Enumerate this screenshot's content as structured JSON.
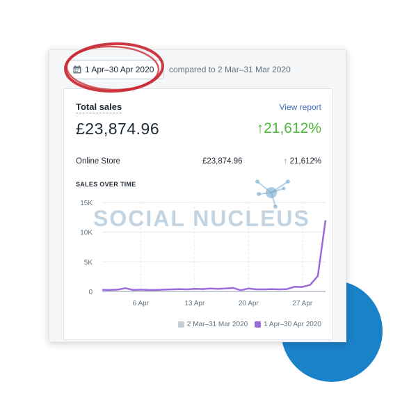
{
  "header": {
    "date_range": "1 Apr–30 Apr 2020",
    "compare_text": "compared to 2 Mar–31 Mar 2020"
  },
  "card": {
    "title": "Total sales",
    "view_report": "View report",
    "total_value": "£23,874.96",
    "total_growth": "21,612%",
    "rows": [
      {
        "name": "Online Store",
        "value": "£23,874.96",
        "growth": "21,612%"
      }
    ]
  },
  "chart_title": "SALES OVER TIME",
  "watermark": "SOCIAL NUCLEUS",
  "colors": {
    "accent_blue": "#1a82c8",
    "growth_green": "#50b83c",
    "series_current": "#9c6ade",
    "series_previous": "#c4cdd5",
    "annotation_red": "#c8242f"
  },
  "icons": {
    "calendar": "calendar-icon",
    "arrow_up": "arrow-up-icon"
  },
  "chart_data": {
    "type": "line",
    "ylim": [
      0,
      15000
    ],
    "yticks": [
      0,
      5000,
      10000,
      15000
    ],
    "ytick_labels": [
      "0",
      "5K",
      "10K",
      "15K"
    ],
    "xtick_days": [
      6,
      13,
      20,
      27
    ],
    "xtick_labels": [
      "6 Apr",
      "13 Apr",
      "20 Apr",
      "27 Apr"
    ],
    "x": [
      1,
      2,
      3,
      4,
      5,
      6,
      7,
      8,
      9,
      10,
      11,
      12,
      13,
      14,
      15,
      16,
      17,
      18,
      19,
      20,
      21,
      22,
      23,
      24,
      25,
      26,
      27,
      28,
      29,
      30
    ],
    "series": [
      {
        "name": "2 Mar–31 Mar 2020",
        "color": "#c4cdd5",
        "values": [
          0,
          0,
          0,
          0,
          0,
          0,
          0,
          0,
          0,
          0,
          0,
          0,
          0,
          0,
          0,
          0,
          0,
          0,
          0,
          0,
          0,
          0,
          0,
          0,
          0,
          0,
          0,
          0,
          0,
          0
        ]
      },
      {
        "name": "1 Apr–30 Apr 2020",
        "color": "#9c6ade",
        "values": [
          250,
          250,
          300,
          550,
          250,
          300,
          250,
          250,
          300,
          350,
          400,
          350,
          450,
          400,
          500,
          450,
          500,
          600,
          200,
          500,
          350,
          350,
          400,
          350,
          400,
          800,
          750,
          1100,
          2600,
          12000
        ]
      }
    ],
    "grid": true,
    "legend_position": "bottom-right"
  }
}
